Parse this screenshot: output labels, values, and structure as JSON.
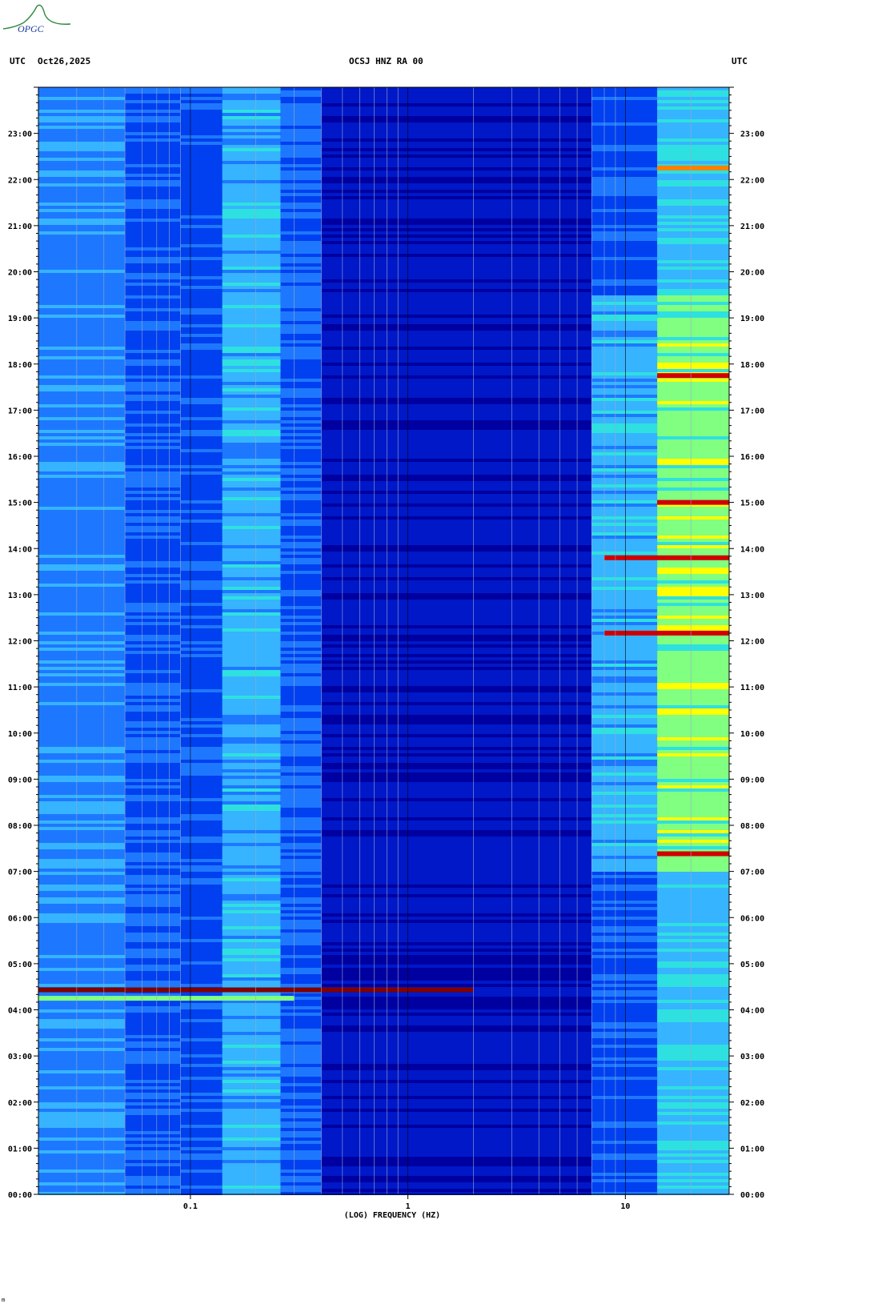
{
  "header": {
    "left_tz": "UTC",
    "date": "Oct26,2025",
    "station": "OCSJ HNZ RA 00",
    "right_tz": "UTC"
  },
  "logo_text": "OPGC",
  "footer_mark": "m",
  "chart_data": {
    "type": "heatmap",
    "title": "OCSJ HNZ RA 00",
    "xlabel": "(LOG) FREQUENCY (HZ)",
    "ylabel": "",
    "x_scale": "log",
    "x_range": [
      0.02,
      30
    ],
    "x_ticks": [
      {
        "value": 0.1,
        "label": "0.1"
      },
      {
        "value": 1,
        "label": "1"
      },
      {
        "value": 10,
        "label": "10"
      }
    ],
    "y_range_hours": [
      0,
      24
    ],
    "y_ticks": [
      "00:00",
      "01:00",
      "02:00",
      "03:00",
      "04:00",
      "05:00",
      "06:00",
      "07:00",
      "08:00",
      "09:00",
      "10:00",
      "11:00",
      "12:00",
      "13:00",
      "14:00",
      "15:00",
      "16:00",
      "17:00",
      "18:00",
      "19:00",
      "20:00",
      "21:00",
      "22:00",
      "23:00"
    ],
    "colormap": [
      "#0000a0",
      "#0018c8",
      "#0040f0",
      "#1e78ff",
      "#36b4ff",
      "#2ee0e0",
      "#80ff80",
      "#ffff00",
      "#ff8000",
      "#d00000",
      "#800000"
    ],
    "bands": [
      {
        "f_lo": 0.02,
        "f_hi": 0.05,
        "level": 0.32
      },
      {
        "f_lo": 0.05,
        "f_hi": 0.09,
        "level": 0.24
      },
      {
        "f_lo": 0.09,
        "f_hi": 0.14,
        "level": 0.22
      },
      {
        "f_lo": 0.14,
        "f_hi": 0.26,
        "level": 0.4
      },
      {
        "f_lo": 0.26,
        "f_hi": 0.4,
        "level": 0.26
      },
      {
        "f_lo": 0.4,
        "f_hi": 7.0,
        "level": 0.08
      },
      {
        "f_lo": 7.0,
        "f_hi": 14,
        "level": 0.22
      },
      {
        "f_lo": 14,
        "f_hi": 30,
        "level": 0.42
      }
    ],
    "events": [
      {
        "time": "04:26",
        "f_lo": 0.02,
        "f_hi": 2.0,
        "level": 0.95
      },
      {
        "time": "04:15",
        "f_lo": 0.02,
        "f_hi": 0.3,
        "level": 0.6
      },
      {
        "time": "07:23",
        "f_lo": 14,
        "f_hi": 30,
        "level": 0.85
      },
      {
        "time": "12:10",
        "f_lo": 8,
        "f_hi": 30,
        "level": 0.9
      },
      {
        "time": "13:48",
        "f_lo": 8,
        "f_hi": 30,
        "level": 0.85
      },
      {
        "time": "15:00",
        "f_lo": 14,
        "f_hi": 30,
        "level": 0.85
      },
      {
        "time": "17:45",
        "f_lo": 14,
        "f_hi": 30,
        "level": 0.85
      },
      {
        "time": "22:15",
        "f_lo": 14,
        "f_hi": 30,
        "level": 0.8
      }
    ],
    "grid": true
  }
}
